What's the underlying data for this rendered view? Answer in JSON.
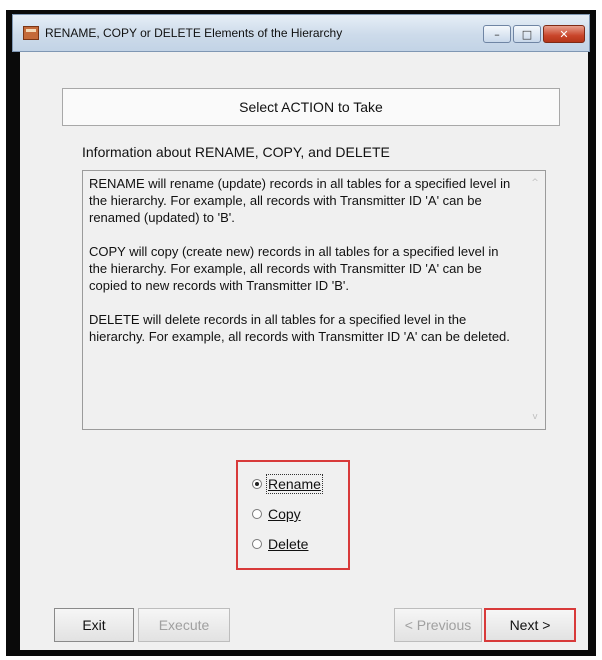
{
  "window": {
    "title": "RENAME, COPY or DELETE Elements of the Hierarchy",
    "controls": {
      "minimize": "–",
      "maximize": "□",
      "close": "✕"
    }
  },
  "header": {
    "label": "Select ACTION to Take"
  },
  "info": {
    "label": "Information about RENAME, COPY, and DELETE",
    "paragraphs": [
      "RENAME will rename (update) records in all tables for a specified level in the hierarchy. For example, all records with Transmitter ID 'A' can be renamed (updated) to 'B'.",
      "COPY will copy (create new) records in all tables for a specified level in the hierarchy. For example, all records with Transmitter ID 'A' can be copied to new records with Transmitter ID 'B'.",
      "DELETE will delete records in all tables for a specified level in the hierarchy. For example, all records with Transmitter ID 'A' can be deleted."
    ],
    "scroll_up": "^",
    "scroll_down": "v"
  },
  "actions": {
    "selected": "Rename",
    "options": [
      {
        "label": "Rename"
      },
      {
        "label": "Copy"
      },
      {
        "label": "Delete"
      }
    ]
  },
  "buttons": {
    "exit": "Exit",
    "execute": "Execute",
    "previous": "< Previous",
    "next": "Next >"
  },
  "colors": {
    "highlight": "#d83a3a",
    "client_bg": "#f0f0f0"
  }
}
